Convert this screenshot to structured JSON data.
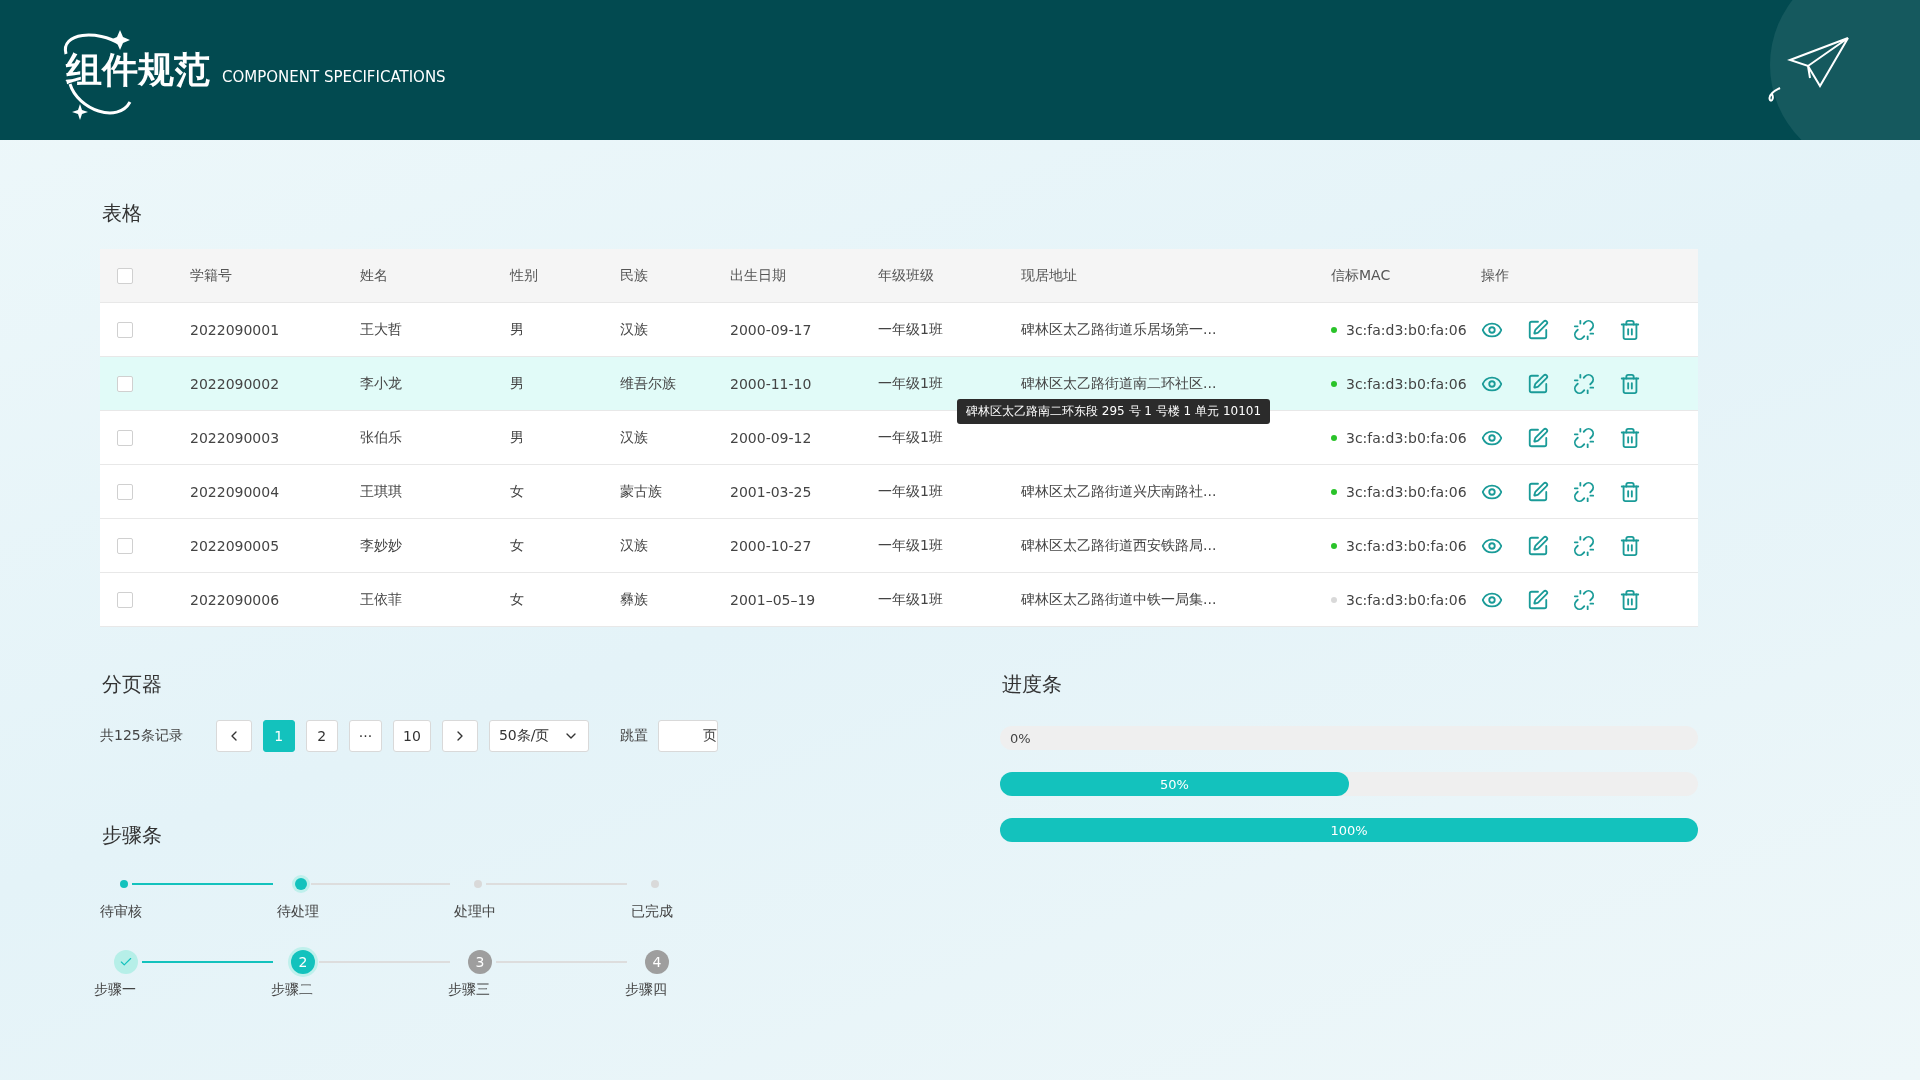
{
  "header": {
    "title": "组件规范",
    "subtitle": "COMPONENT SPECIFICATIONS"
  },
  "table_section": {
    "title": "表格",
    "columns": [
      "学籍号",
      "姓名",
      "性别",
      "民族",
      "出生日期",
      "年级班级",
      "现居地址",
      "信标MAC",
      "操作"
    ],
    "header_checked": false,
    "rows": [
      {
        "checked": false,
        "hovered": false,
        "cells": [
          "2022090001",
          "王大哲",
          "男",
          "汉族",
          "2000-09-17",
          "一年级1班"
        ],
        "address": "碑林区太乙路街道乐居场第一...",
        "mac": "3c:fa:d3:b0:fa:06",
        "color": "#2ac32a"
      },
      {
        "checked": false,
        "hovered": true,
        "cells": [
          "2022090002",
          "李小龙",
          "男",
          "维吾尔族",
          "2000-11-10",
          "一年级1班"
        ],
        "address": "碑林区太乙路街道南二环社区...",
        "mac": "3c:fa:d3:b0:fa:06",
        "color": "#2ac32a",
        "tooltip": "碑林区太乙路南二环东段 295 号 1 号楼 1 单元 10101"
      },
      {
        "checked": false,
        "hovered": false,
        "cells": [
          "2022090003",
          "张伯乐",
          "男",
          "汉族",
          "2000-09-12",
          "一年级1班"
        ],
        "mac": "3c:fa:d3:b0:fa:06",
        "color": "#2ac32a"
      },
      {
        "checked": false,
        "hovered": false,
        "cells": [
          "2022090004",
          "王琪琪",
          "女",
          "蒙古族",
          "2001-03-25",
          "一年级1班"
        ],
        "address": "碑林区太乙路街道兴庆南路社...",
        "mac": "3c:fa:d3:b0:fa:06",
        "color": "#2ac32a"
      },
      {
        "checked": false,
        "hovered": false,
        "cells": [
          "2022090005",
          "李妙妙",
          "女",
          "汉族",
          "2000-10-27",
          "一年级1班"
        ],
        "address": "碑林区太乙路街道西安铁路局...",
        "mac": "3c:fa:d3:b0:fa:06",
        "color": "#2ac32a"
      },
      {
        "checked": false,
        "hovered": false,
        "cells": [
          "2022090006",
          "王依菲",
          "女",
          "彝族",
          "2001–05–19",
          "一年级1班"
        ],
        "address": "碑林区太乙路街道中铁一局集...",
        "mac": "3c:fa:d3:b0:fa:06",
        "color": "#d9d9d9"
      }
    ]
  },
  "pagination": {
    "title": "分页器",
    "total": "共125条记录",
    "pages": [
      {
        "label": "1",
        "selected": true
      },
      {
        "label": "2",
        "selected": false
      },
      {
        "label": "···",
        "selected": false
      },
      {
        "label": "10",
        "selected": false
      }
    ],
    "page_size": "50条/页",
    "jump_label": "跳置",
    "jump_suffix": "页"
  },
  "steps_section": {
    "title": "步骤条",
    "dot_steps": [
      {
        "label": "待审核",
        "done": true,
        "current": false
      },
      {
        "label": "待处理",
        "done": false,
        "current": true
      },
      {
        "label": "处理中",
        "done": false,
        "current": false
      },
      {
        "label": "已完成",
        "done": false,
        "current": false
      }
    ],
    "number_steps": [
      {
        "label": "步骤一",
        "done": true,
        "current": false
      },
      {
        "label": "步骤二",
        "number": "2",
        "done": false,
        "current": true
      },
      {
        "label": "步骤三",
        "number": "3",
        "done": false,
        "current": false
      },
      {
        "label": "步骤四",
        "number": "4",
        "done": false,
        "current": false
      }
    ]
  },
  "progress_section": {
    "title": "进度条",
    "bars": [
      {
        "level": 0,
        "reading": "0%"
      },
      {
        "level": 0.5,
        "reading": "50%"
      },
      {
        "level": 1,
        "reading": "100%"
      }
    ]
  }
}
